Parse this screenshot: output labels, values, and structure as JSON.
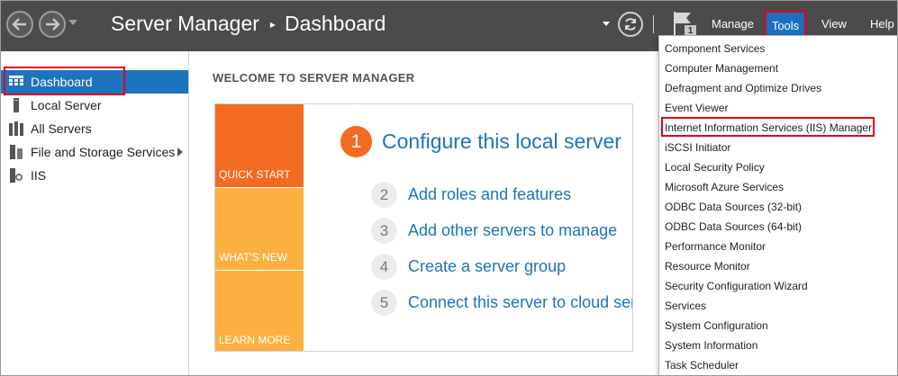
{
  "titlebar": {
    "app": "Server Manager",
    "page": "Dashboard",
    "separator": "▸",
    "flag_count": "1",
    "menu": {
      "manage": "Manage",
      "tools": "Tools",
      "view": "View",
      "help": "Help"
    }
  },
  "sidebar": {
    "items": [
      {
        "label": "Dashboard",
        "icon": "dashboard-icon",
        "active": true
      },
      {
        "label": "Local Server",
        "icon": "server-icon"
      },
      {
        "label": "All Servers",
        "icon": "servers-icon"
      },
      {
        "label": "File and Storage Services",
        "icon": "storage-icon",
        "expandable": true
      },
      {
        "label": "IIS",
        "icon": "iis-icon"
      }
    ]
  },
  "main": {
    "heading": "WELCOME TO SERVER MANAGER",
    "tiles": [
      "QUICK START",
      "WHAT'S NEW",
      "LEARN MORE"
    ],
    "steps": [
      {
        "num": "1",
        "label": "Configure this local server"
      },
      {
        "num": "2",
        "label": "Add roles and features"
      },
      {
        "num": "3",
        "label": "Add other servers to manage"
      },
      {
        "num": "4",
        "label": "Create a server group"
      },
      {
        "num": "5",
        "label": "Connect this server to cloud services"
      }
    ]
  },
  "tools_menu": {
    "items": [
      "Component Services",
      "Computer Management",
      "Defragment and Optimize Drives",
      "Event Viewer",
      "Internet Information Services (IIS) Manager",
      "iSCSI Initiator",
      "Local Security Policy",
      "Microsoft Azure Services",
      "ODBC Data Sources (32-bit)",
      "ODBC Data Sources (64-bit)",
      "Performance Monitor",
      "Resource Monitor",
      "Security Configuration Wizard",
      "Services",
      "System Configuration",
      "System Information",
      "Task Scheduler"
    ],
    "highlighted_index": 4
  },
  "colors": {
    "titlebar": "#4b4b4b",
    "accent": "#1e73be",
    "quick_start": "#f26b21",
    "tile": "#fbb040",
    "highlight": "#e0001a"
  }
}
